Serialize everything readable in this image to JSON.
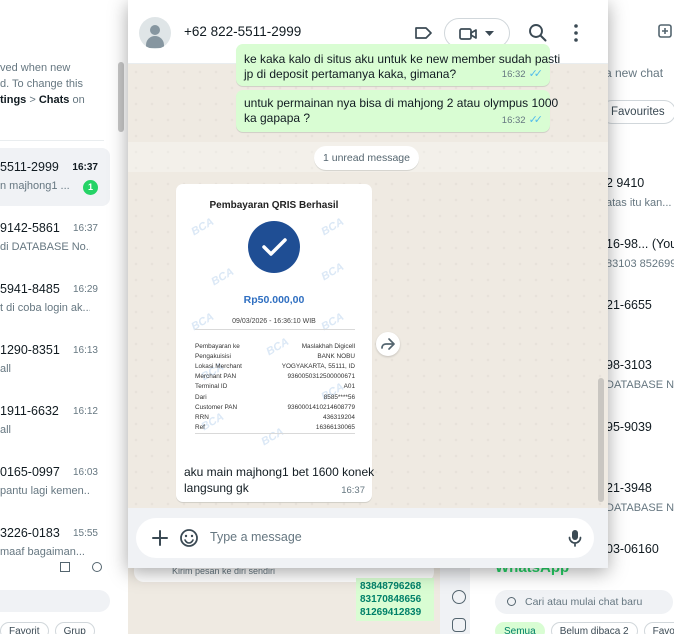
{
  "background_right": {
    "search_hint": "a new chat",
    "favourites_chip": "Favourites",
    "rows": [
      {
        "title": "2 9410",
        "subtitle": "atas itu kan..."
      },
      {
        "title": "16-98... (You",
        "subtitle": "83103 852699"
      },
      {
        "title": "21-6655",
        "subtitle": ""
      },
      {
        "title": "98-3103",
        "subtitle": "DATABASE N"
      },
      {
        "title": "95-9039",
        "subtitle": ""
      },
      {
        "title": "21-3948",
        "subtitle": "DATABASE N"
      },
      {
        "title": "03-06160",
        "subtitle": ""
      }
    ],
    "app_title": "WhatsApp",
    "search_placeholder": "Cari atau mulai chat baru",
    "filters": [
      "Semua",
      "Belum dibaca 2",
      "Favorit"
    ]
  },
  "background_middle": {
    "input_placeholder": "Kirim pesan ke diri sendiri",
    "numbers": [
      "83848796268",
      "83170848656",
      "81269412839"
    ]
  },
  "background_left": {
    "notice_lines": [
      "ved when new",
      "d. To change this"
    ],
    "notice_path_bold_1": "tings",
    "notice_path_sep": " > ",
    "notice_path_bold_2": "Chats",
    "notice_path_tail": " on",
    "chats": [
      {
        "number": "5511-2999",
        "time": "16:37",
        "preview": "n majhong1 ...",
        "unread": "1",
        "active": true
      },
      {
        "number": "9142-5861",
        "time": "16:37",
        "preview": "di DATABASE No...",
        "unread": ""
      },
      {
        "number": "5941-8485",
        "time": "16:29",
        "preview": "t di coba login ak...",
        "unread": ""
      },
      {
        "number": "1290-8351",
        "time": "16:13",
        "preview": "all",
        "unread": ""
      },
      {
        "number": "1911-6632",
        "time": "16:12",
        "preview": "all",
        "unread": ""
      },
      {
        "number": "0165-0997",
        "time": "16:03",
        "preview": "pantu lagi kemen...",
        "unread": ""
      },
      {
        "number": "3226-0183",
        "time": "15:55",
        "preview": "maaf bagaiman...",
        "unread": ""
      }
    ],
    "chips": [
      "Favorit",
      "Grup"
    ]
  },
  "chat": {
    "contact_name": "+62 822-5511-2999",
    "messages": [
      {
        "direction": "out",
        "lines": [
          "ke kaka kalo di situs aku untuk ke new member sudah pasti",
          "jp di deposit pertamanya kaka, gimana?"
        ],
        "time": "16:32",
        "status": "read"
      },
      {
        "direction": "out",
        "lines": [
          "untuk permainan nya bisa di mahjong 2 atau olympus 1000",
          "ka gapapa ?"
        ],
        "time": "16:32",
        "status": "read"
      }
    ],
    "unread_banner": "1 unread message",
    "receipt": {
      "title": "Pembayaran QRIS Berhasil",
      "watermark": "BCA",
      "amount": "Rp50.000,00",
      "datetime": "09/03/2026 - 16:36:10 WIB",
      "fields": [
        {
          "label": "Pembayaran ke",
          "value": "Maslakhah Digicell"
        },
        {
          "label": "Pengakuisisi",
          "value": "BANK NOBU"
        },
        {
          "label": "Lokasi Merchant",
          "value": "YOGYAKARTA, 55111, ID"
        },
        {
          "label": "Merchant PAN",
          "value": "9360050312500000671"
        },
        {
          "label": "Terminal ID",
          "value": "A01"
        },
        {
          "label": "Dari",
          "value": "8585****56"
        },
        {
          "label": "Customer PAN",
          "value": "9360001410214608779"
        },
        {
          "label": "RRN",
          "value": "436319204"
        },
        {
          "label": "Ref",
          "value": "16366130065"
        }
      ]
    },
    "incoming_caption_lines": [
      "aku main majhong1 bet 1600 konek",
      "langsung gk"
    ],
    "incoming_time": "16:37",
    "composer_placeholder": "Type a message"
  },
  "icons": {
    "avatar": "default-avatar-icon",
    "label": "label-icon",
    "video": "video-call-icon",
    "dropdown": "chevron-down-icon",
    "search": "search-icon",
    "menu": "more-vertical-icon",
    "forward": "forward-icon",
    "attach": "plus-icon",
    "emoji": "emoji-icon",
    "mic": "microphone-icon",
    "read": "double-check-icon"
  },
  "colors": {
    "outgoing_bubble": "#d9fdd3",
    "chat_background": "#efeae2",
    "read_ticks": "#53bdeb",
    "unread_badge": "#25d366",
    "receipt_check": "#1f4e94",
    "receipt_amount": "#2f6fc1"
  }
}
